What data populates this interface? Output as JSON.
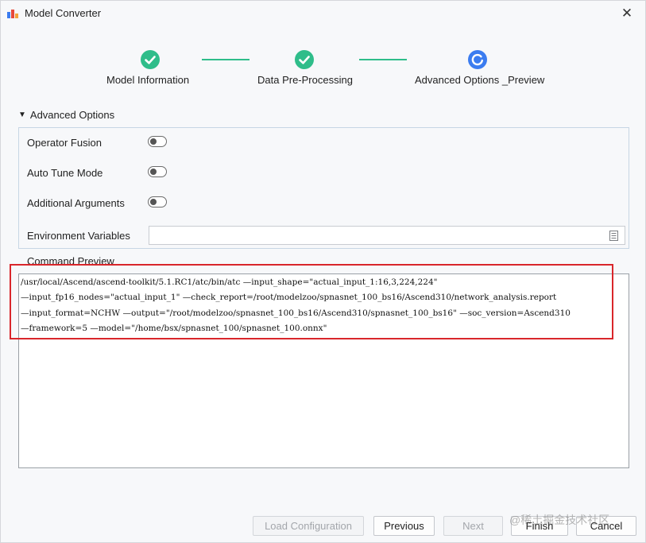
{
  "window": {
    "title": "Model Converter",
    "close_glyph": "✕",
    "app_icon": "ascend-logo-icon"
  },
  "steps": [
    {
      "label": "Model Information",
      "state": "done"
    },
    {
      "label": "Data Pre-Processing",
      "state": "done"
    },
    {
      "label": "Advanced Options _Preview",
      "state": "in-progress"
    }
  ],
  "colors": {
    "step_done": "#2fbd8a",
    "step_active": "#3b7cf0",
    "highlight_border": "#d9262b"
  },
  "advanced": {
    "caret": "▼",
    "title": "Advanced Options",
    "options": [
      {
        "label": "Operator Fusion",
        "enabled": false
      },
      {
        "label": "Auto Tune Mode",
        "enabled": false
      },
      {
        "label": "Additional Arguments",
        "enabled": false
      }
    ],
    "env_label": "Environment Variables",
    "env_value": ""
  },
  "command": {
    "label": "Command Preview",
    "lines": [
      "/usr/local/Ascend/ascend-toolkit/5.1.RC1/atc/bin/atc  —input_shape=\"actual_input_1:16,3,224,224\"",
      "—input_fp16_nodes=\"actual_input_1\" —check_report=/root/modelzoo/spnasnet_100_bs16/Ascend310/network_analysis.report",
      "—input_format=NCHW —output=\"/root/modelzoo/spnasnet_100_bs16/Ascend310/spnasnet_100_bs16\" —soc_version=Ascend310",
      "—framework=5 —model=\"/home/bsx/spnasnet_100/spnasnet_100.onnx\""
    ]
  },
  "footer": {
    "load_config": "Load Configuration",
    "previous": "Previous",
    "next": "Next",
    "finish": "Finish",
    "cancel": "Cancel",
    "watermark": "@稀土掘金技术社区"
  }
}
